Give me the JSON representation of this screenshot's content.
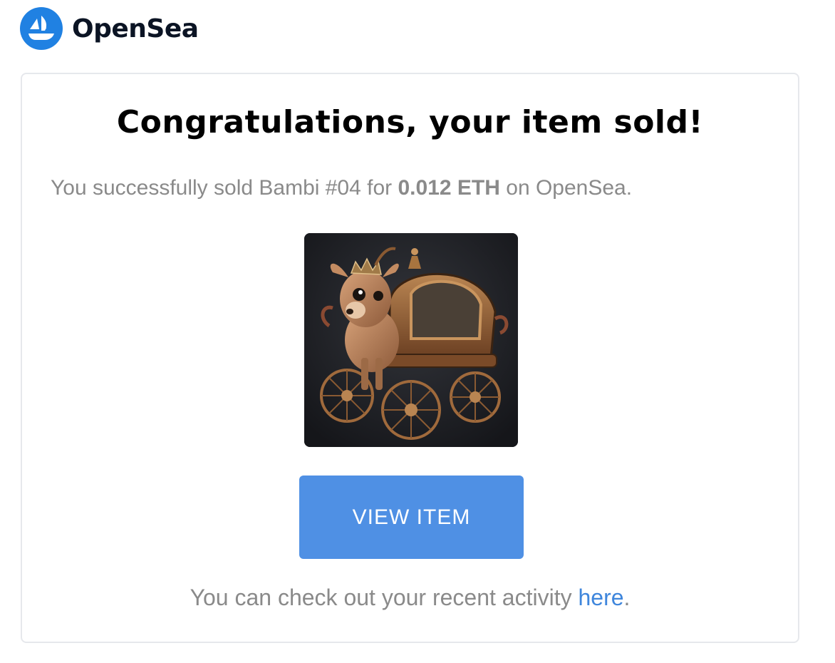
{
  "brand": {
    "name": "OpenSea",
    "logo_icon": "opensea-ship-icon",
    "accent_color": "#2081E2"
  },
  "card": {
    "title": "Congratulations, your item sold!",
    "message": {
      "prefix": "You successfully sold Bambi #04 for ",
      "price": "0.012 ETH",
      "suffix": " on OpenSea."
    },
    "image": {
      "subject": "deer-carriage-artwork"
    },
    "button_label": "VIEW ITEM",
    "button_color": "#4F90E4",
    "footer": {
      "prefix": "You can check out your recent activity ",
      "link_text": "here",
      "suffix": "."
    }
  }
}
